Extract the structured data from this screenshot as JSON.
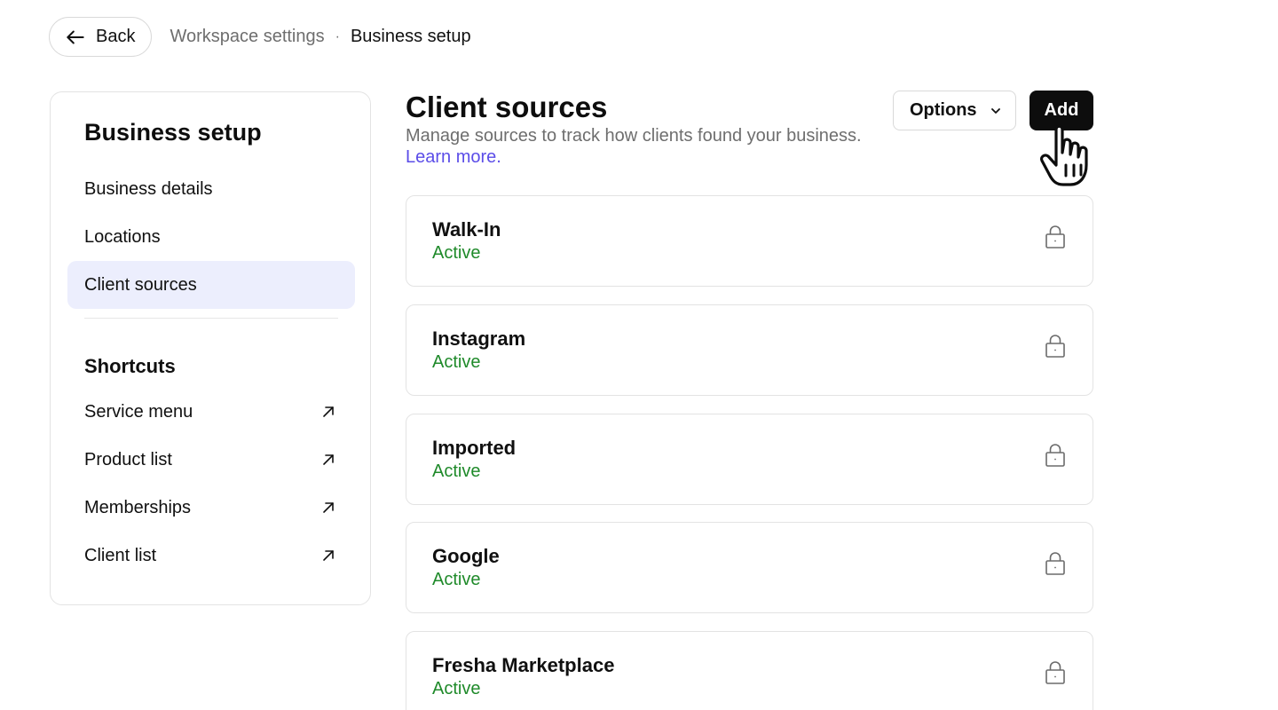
{
  "topbar": {
    "back_label": "Back",
    "breadcrumb": {
      "parent": "Workspace settings",
      "separator": "·",
      "current": "Business setup"
    }
  },
  "sidebar": {
    "title": "Business setup",
    "items": [
      {
        "label": "Business details",
        "active": false
      },
      {
        "label": "Locations",
        "active": false
      },
      {
        "label": "Client sources",
        "active": true
      }
    ],
    "shortcuts_title": "Shortcuts",
    "shortcuts": [
      {
        "label": "Service menu",
        "icon": "external-link-arrow-icon"
      },
      {
        "label": "Product list",
        "icon": "external-link-arrow-icon"
      },
      {
        "label": "Memberships",
        "icon": "external-link-arrow-icon"
      },
      {
        "label": "Client list",
        "icon": "external-link-arrow-icon"
      }
    ]
  },
  "main": {
    "title": "Client sources",
    "subtitle": "Manage sources to track how clients found your business.",
    "learn_more": "Learn more.",
    "options_label": "Options",
    "add_label": "Add",
    "sources": [
      {
        "name": "Walk-In",
        "status": "Active",
        "icon": "lock-icon"
      },
      {
        "name": "Instagram",
        "status": "Active",
        "icon": "lock-icon"
      },
      {
        "name": "Imported",
        "status": "Active",
        "icon": "lock-icon"
      },
      {
        "name": "Google",
        "status": "Active",
        "icon": "lock-icon"
      },
      {
        "name": "Fresha Marketplace",
        "status": "Active",
        "icon": "lock-icon"
      }
    ]
  },
  "colors": {
    "accent_link": "#5b4de8",
    "active_status": "#1f8a2a",
    "active_nav_bg": "#eceefd",
    "primary_button": "#0d0d0d"
  }
}
